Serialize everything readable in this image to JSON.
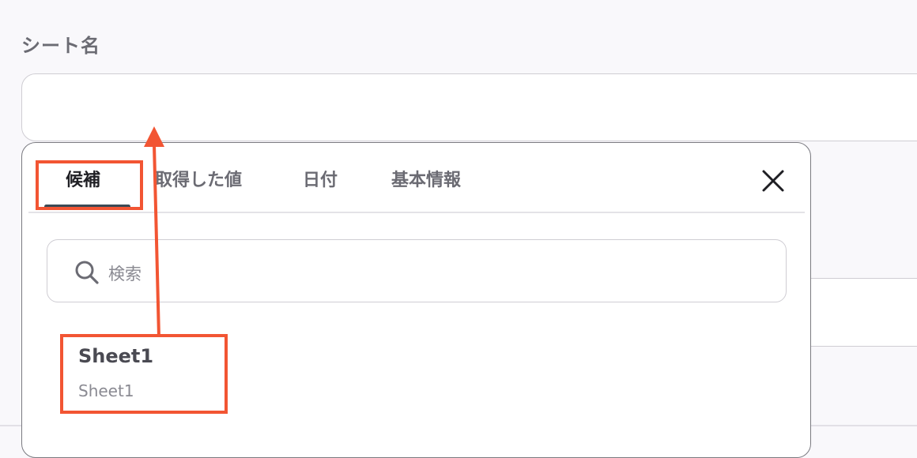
{
  "form": {
    "sheet_name_label": "シート名",
    "sheet_name_value": ""
  },
  "popover": {
    "tabs": [
      {
        "label": "候補",
        "active": true
      },
      {
        "label": "取得した値",
        "active": false
      },
      {
        "label": "日付",
        "active": false
      },
      {
        "label": "基本情報",
        "active": false
      }
    ],
    "close_icon": "close-icon",
    "search": {
      "placeholder": "検索",
      "icon": "search-icon"
    },
    "candidates": [
      {
        "title": "Sheet1",
        "subtitle": "Sheet1"
      }
    ]
  },
  "annotation": {
    "color": "#f25533"
  }
}
